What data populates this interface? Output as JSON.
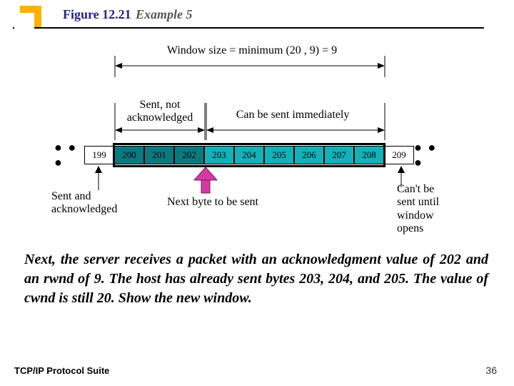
{
  "header": {
    "figure_label": "Figure 12.21",
    "example_label": "Example 5"
  },
  "diagram": {
    "window_size_text": "Window size = minimum (20 , 9) = 9",
    "top_left_label": "Sent, not\nacknowledged",
    "top_right_label": "Can be sent immediately",
    "bottom_left_label": "Sent and\nacknowledged",
    "bottom_mid_label": "Next byte to be sent",
    "bottom_right_label": "Can't be\nsent until\nwindow\nopens",
    "cells": [
      "● ● ●",
      "199",
      "200",
      "201",
      "202",
      "203",
      "204",
      "205",
      "206",
      "207",
      "208",
      "209",
      "● ● ●"
    ]
  },
  "body": "Next, the server receives a packet with an acknowledgment value of 202 and an rwnd of 9. The host has already sent bytes 203, 204, and 205. The value of cwnd is still 20. Show the new window.",
  "footer": {
    "left": "TCP/IP Protocol Suite",
    "page": "36"
  },
  "chart_data": {
    "type": "table",
    "description": "TCP sliding window illustration",
    "bytes": [
      199,
      200,
      201,
      202,
      203,
      204,
      205,
      206,
      207,
      208,
      209
    ],
    "window_start": 200,
    "window_end": 208,
    "sent_not_acked": [
      200,
      201,
      202
    ],
    "can_be_sent": [
      203,
      204,
      205,
      206,
      207,
      208
    ],
    "next_byte_to_send": 203,
    "rwnd": 9,
    "cwnd": 20,
    "window_size": 9
  }
}
